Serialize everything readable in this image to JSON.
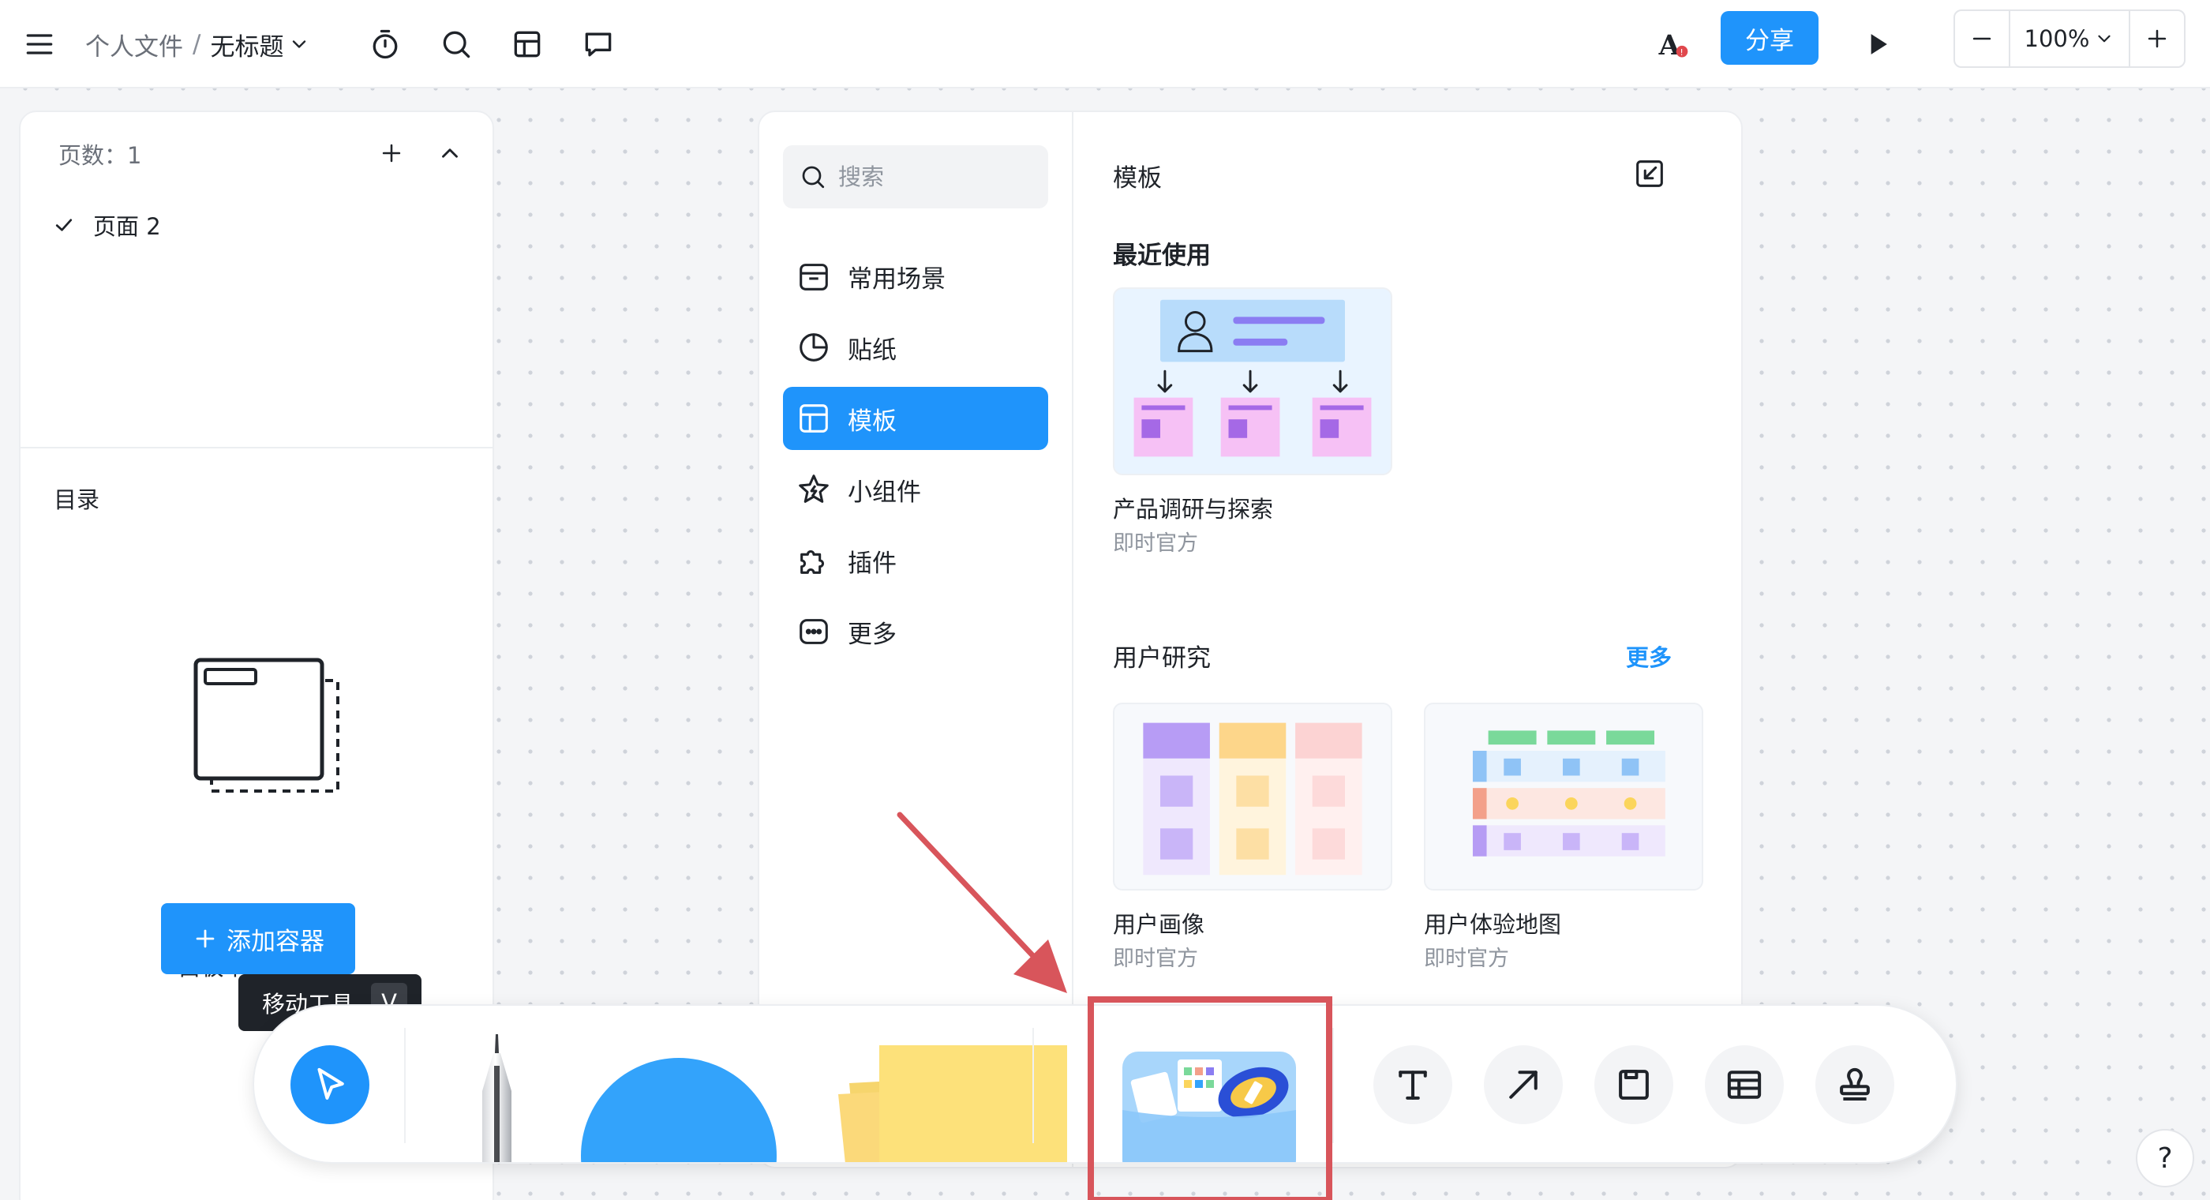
{
  "header": {
    "breadcrumb_root": "个人文件",
    "separator": "/",
    "doc_title": "无标题",
    "share_label": "分享",
    "zoom": "100%"
  },
  "left_panel": {
    "pages_label": "页数：1",
    "pages": [
      {
        "label": "页面 2",
        "selected": true
      }
    ],
    "toc_label": "目录",
    "empty_text": "白板中暂无容器",
    "add_container_label": "添加容器"
  },
  "template_panel": {
    "search_placeholder": "搜索",
    "nav": [
      {
        "label": "常用场景",
        "icon": "calendar-box-icon",
        "active": false
      },
      {
        "label": "贴纸",
        "icon": "sticker-icon",
        "active": false
      },
      {
        "label": "模板",
        "icon": "template-layout-icon",
        "active": true
      },
      {
        "label": "小组件",
        "icon": "widget-star-icon",
        "active": false
      },
      {
        "label": "插件",
        "icon": "puzzle-plugin-icon",
        "active": false
      },
      {
        "label": "更多",
        "icon": "more-dots-icon",
        "active": false
      }
    ],
    "title": "模板",
    "recent_title": "最近使用",
    "recent": [
      {
        "name": "产品调研与探索",
        "sub": "即时官方"
      }
    ],
    "section": {
      "title": "用户研究",
      "more_label": "更多",
      "cards": [
        {
          "name": "用户画像",
          "sub": "即时官方"
        },
        {
          "name": "用户体验地图",
          "sub": "即时官方"
        }
      ]
    }
  },
  "tooltip": {
    "label": "移动工具",
    "shortcut": "V"
  },
  "toolbar": {
    "tools": [
      "move-tool",
      "pen-tool",
      "shape-tool",
      "sticky-note-tool",
      "material-library-tool",
      "text-tool",
      "connector-arrow-tool",
      "container-frame-tool",
      "table-tool",
      "stamp-tool"
    ]
  },
  "help_label": "?",
  "colors": {
    "accent": "#1f94fb",
    "annotation": "#d8555b",
    "sticky_yellow": "#fde17a",
    "shape_blue": "#33a3fb"
  }
}
